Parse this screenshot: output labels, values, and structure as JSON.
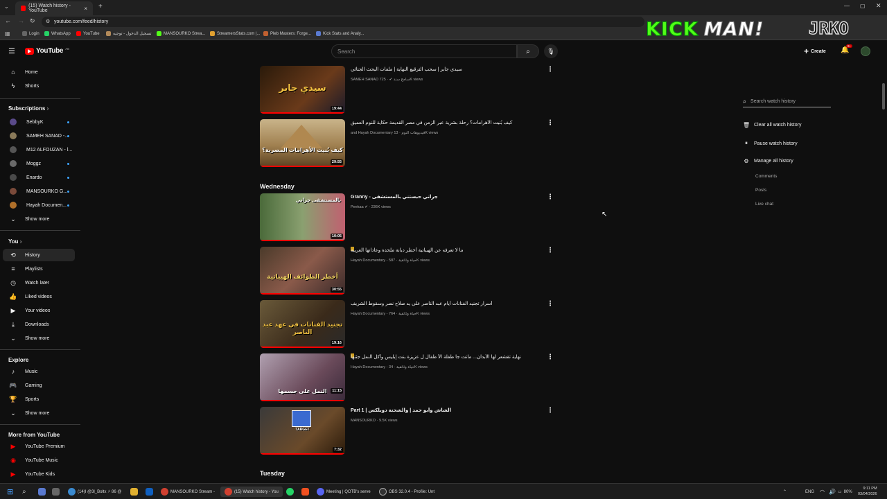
{
  "browser": {
    "tab_title": "(15) Watch history - YouTube",
    "url": "youtube.com/feed/history",
    "bookmarks": [
      "Login",
      "WhatsApp",
      "YouTube",
      "تسجيل الدخول - توجيه",
      "MANSOURKO Strea...",
      "StreamersStats.com |...",
      "Pleb Masters: Forge...",
      "Kick Stats and Analy..."
    ]
  },
  "overlay": {
    "logo1": "KICK",
    "logo1b": "MAN!",
    "logo2": "JRKO"
  },
  "youtube": {
    "logo": "YouTube",
    "region": "AE",
    "search_placeholder": "Search",
    "create_label": "Create",
    "notif_count": "9+"
  },
  "sidebar": {
    "home": "Home",
    "shorts": "Shorts",
    "subscriptions_header": "Subscriptions",
    "subscriptions": [
      {
        "name": "SebbyK",
        "color": "#5a4a8a",
        "live": true
      },
      {
        "name": "SAMEH SANAD -...",
        "color": "#8a7a5a",
        "live": true
      },
      {
        "name": "M12 ALFOUZAN - ا...",
        "color": "#555555",
        "live": false
      },
      {
        "name": "Moggz",
        "color": "#6a6a6a",
        "live": true
      },
      {
        "name": "Enardo",
        "color": "#4a4a4a",
        "live": true
      },
      {
        "name": "MANSOURKO G...",
        "color": "#7a4a3a",
        "live": true
      },
      {
        "name": "Hayah Documen...",
        "color": "#b0702a",
        "live": true
      }
    ],
    "show_more_1": "Show more",
    "you_header": "You",
    "you_items": [
      "History",
      "Playlists",
      "Watch later",
      "Liked videos",
      "Your videos",
      "Downloads"
    ],
    "show_more_2": "Show more",
    "explore_header": "Explore",
    "explore_items": [
      "Music",
      "Gaming",
      "Sports"
    ],
    "show_more_3": "Show more",
    "more_header": "More from YouTube",
    "more_items": [
      "YouTube Premium",
      "YouTube Music",
      "YouTube Kids"
    ]
  },
  "history": {
    "groups": [
      {
        "day": "Wednesday"
      },
      {
        "day": "Tuesday"
      }
    ],
    "videos": [
      {
        "title": "سيدي جابر | سحب الترقيع النهاية | ملفات البحث الجنائي",
        "channel": "SAMEH SANAD سامح سند",
        "views": "725K views",
        "duration": "19:44",
        "thumb_text": "سيدي جابر",
        "thumb_color": "#5a3a1a",
        "progress": 1.0
      },
      {
        "title": "كيف بُنيت الأهرامات؟ رحلة بشرية عبر الزمن في مصر القديمة حكاية للنوم العميق",
        "channel": "and Hayah Documentary فيديوهات النوم",
        "views": "13K views",
        "duration": "29:55",
        "thumb_text": "كيف بُنيت الأهرامات المصرية؟",
        "thumb_color": "#8a6a3a",
        "progress": 1.0
      },
      {
        "title": "Granny - جراني حبستني بالمستشفى",
        "channel": "Peekaa",
        "views": "236K views",
        "duration": "10:05",
        "thumb_text": "بالمستشفى جراني",
        "thumb_color": "#3a5a2a",
        "progress": 1.0
      },
      {
        "title": "ما لا تعرفه عن الهيباتية أخطر ديانة ملحدة وعاداتها الغريبة",
        "channel": "Hayah Documentary - حياة وثائقية",
        "views": "587K views",
        "duration": "30:55",
        "thumb_text": "أخطر الطوائف الهيباتية",
        "thumb_color": "#6a4a3a",
        "progress": 1.0
      },
      {
        "title": "أسرار تجنيد الفنانات أيام عبد الناصر على يد صلاح نصر وسقوط الشريف",
        "channel": "Hayah Documentary - حياة وثائقية",
        "views": "764K views",
        "duration": "19:16",
        "thumb_text": "تجنيد الفنانات في عهد عبد الناصر",
        "thumb_color": "#5a4a2a",
        "progress": 1.0
      },
      {
        "title": "نهاية تقشعر لها الأبدان... ماتت جا طفلة الأ طفال ل عزيزة بنت إبليس وأكل النمل جثتها",
        "channel": "Hayah Documentary - حياة وثائقية",
        "views": "34K views",
        "duration": "11:15",
        "thumb_text": "النمل على جسمها",
        "thumb_color": "#6a5a6a",
        "progress": 1.0
      },
      {
        "title": "Part 1 | الشاش وأبو حمد | والشحنة دوبلكس",
        "channel": "MANSOURKO",
        "views": "9.5K views",
        "duration": "7:32",
        "thumb_text": "TARGET",
        "thumb_color": "#4a3a2a",
        "progress": 1.0
      }
    ]
  },
  "right_panel": {
    "search_placeholder": "Search watch history",
    "clear": "Clear all watch history",
    "pause": "Pause watch history",
    "manage": "Manage all history",
    "sub_items": [
      "Comments",
      "Posts",
      "Live chat"
    ]
  },
  "taskbar": {
    "items": [
      "(14)I @3l_Boltx ⚡ 86 @",
      "MANSOURKO Stream -",
      "(15) Watch history - You",
      "Meeting | QOTB's serve",
      "OBS 32.0.4 - Profile: Unt"
    ],
    "lang": "ENG",
    "battery": "80%",
    "time": "9:11 PM",
    "date": "03/04/2026"
  }
}
